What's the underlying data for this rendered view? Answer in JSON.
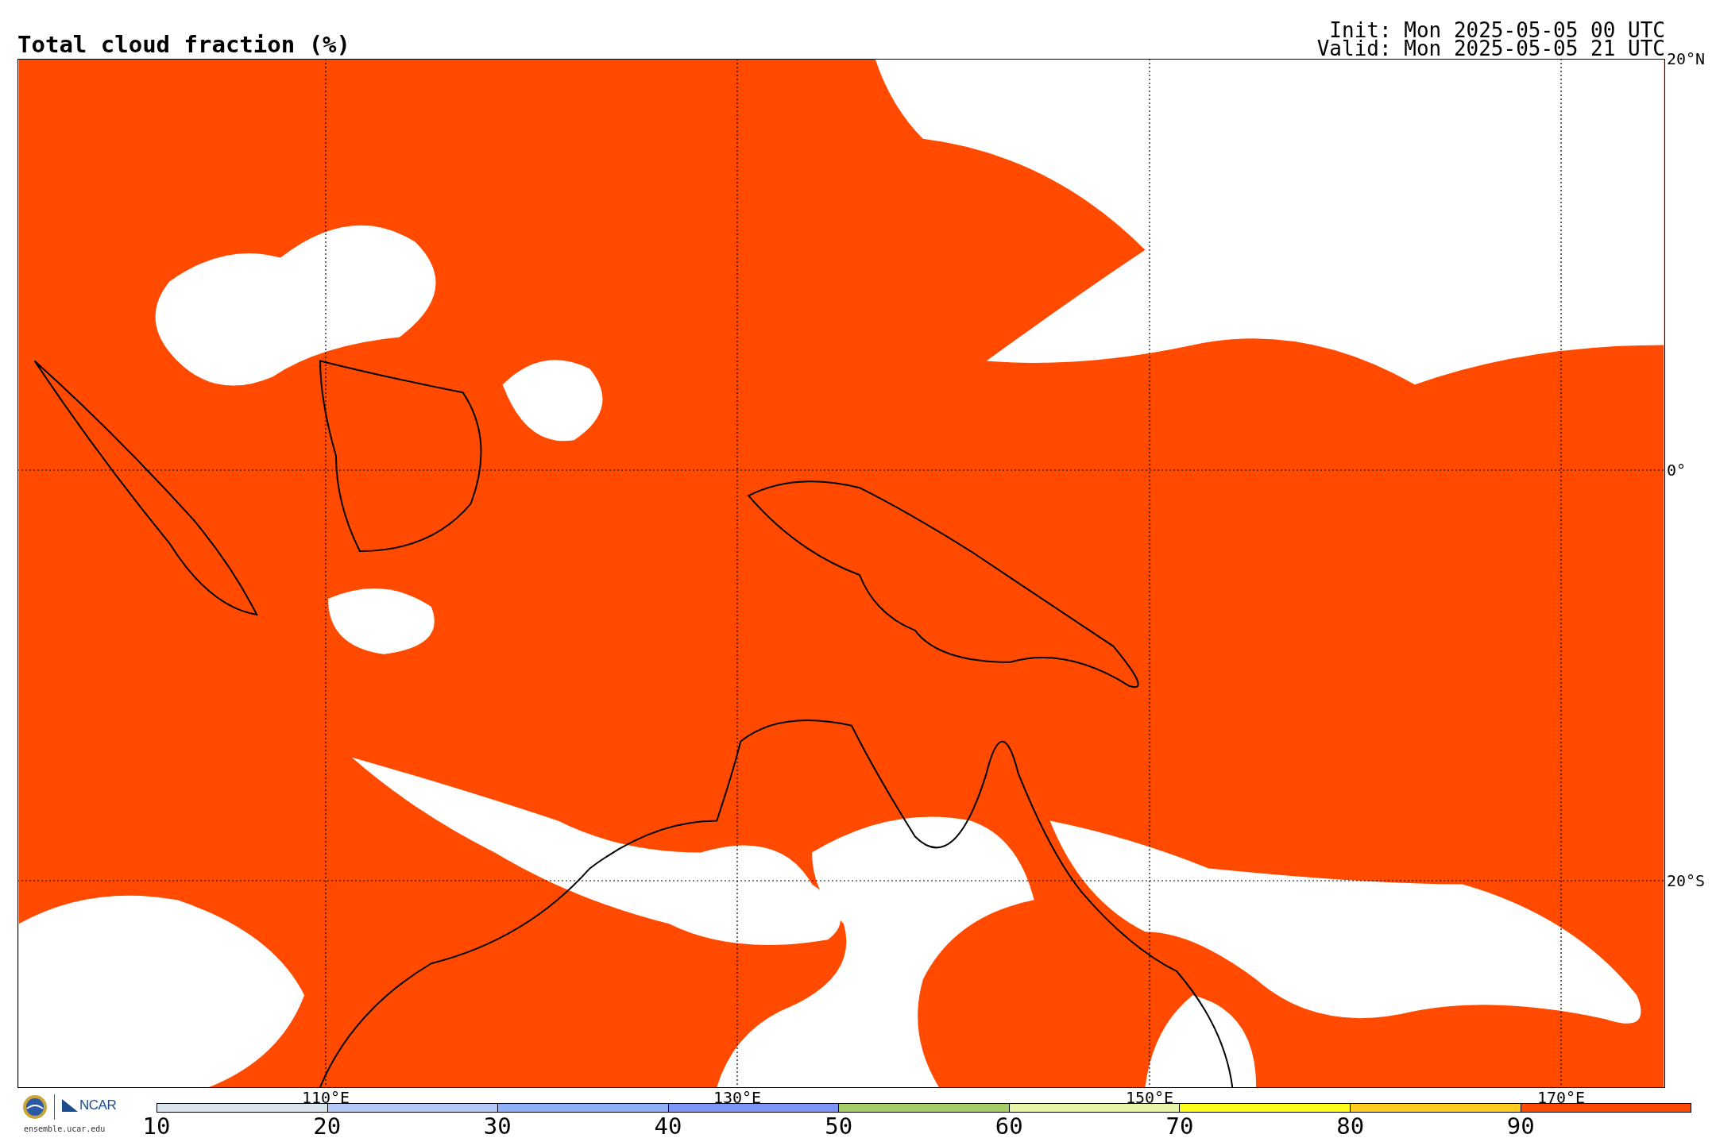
{
  "title": "Total cloud fraction (%)",
  "init": "Init: Mon 2025-05-05 00 UTC",
  "valid": "Valid: Mon 2025-05-05 21 UTC",
  "map": {
    "lat_labels": [
      "20°N",
      "0°",
      "20°S"
    ],
    "lon_labels": [
      "110°E",
      "130°E",
      "150°E",
      "170°E"
    ]
  },
  "colorbar": [
    {
      "label": "10",
      "color": "#d9e3ee"
    },
    {
      "label": "20",
      "color": "#b4c8f8"
    },
    {
      "label": "30",
      "color": "#8fb0f8"
    },
    {
      "label": "40",
      "color": "#7f95f5"
    },
    {
      "label": "50",
      "color": "#a8cc66"
    },
    {
      "label": "60",
      "color": "#e8f4a8"
    },
    {
      "label": "70",
      "color": "#ffff1a"
    },
    {
      "label": "80",
      "color": "#ffcc22"
    },
    {
      "label": "90",
      "color": "#ff4a00"
    }
  ],
  "logo": {
    "name": "NCAR",
    "site": "ensemble.ucar.edu"
  }
}
